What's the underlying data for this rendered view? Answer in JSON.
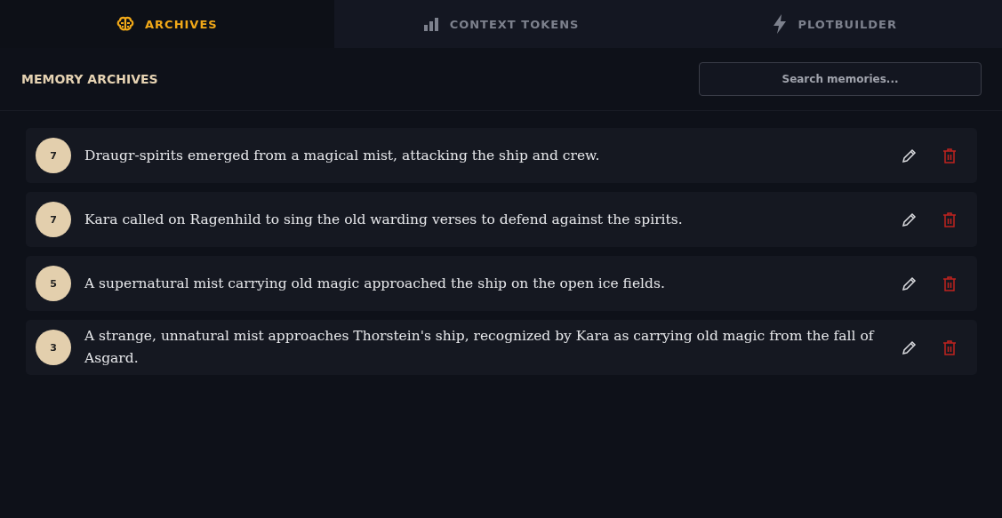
{
  "tabs": [
    {
      "label": "ARCHIVES",
      "selected": true
    },
    {
      "label": "CONTEXT TOKENS",
      "selected": false
    },
    {
      "label": "PLOTBUILDER",
      "selected": false
    }
  ],
  "header": {
    "title": "MEMORY ARCHIVES",
    "search": {
      "placeholder": "Search memories..."
    }
  },
  "memories": [
    {
      "score": "7",
      "text": "Draugr-spirits emerged from a magical mist, attacking the ship and crew."
    },
    {
      "score": "7",
      "text": "Kara called on Ragenhild to sing the old warding verses to defend against the spirits."
    },
    {
      "score": "5",
      "text": "A supernatural mist carrying old magic approached the ship on the open ice fields."
    },
    {
      "score": "3",
      "text": "A strange, unnatural mist approaches Thorstein's ship, recognized by Kara as carrying old magic from the fall of Asgard."
    }
  ]
}
